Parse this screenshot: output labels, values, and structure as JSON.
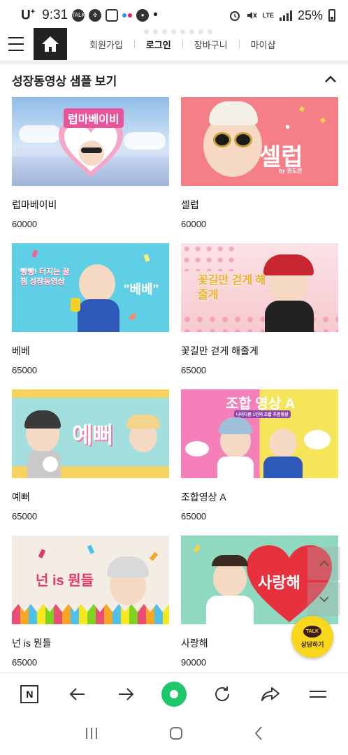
{
  "status": {
    "carrier": "U",
    "carrier_sup": "+",
    "time": "9:31",
    "talk_icon_text": "TALK",
    "network": "LTE",
    "battery": "25%"
  },
  "header": {
    "nav": [
      "회원가입",
      "로그인",
      "장바구니",
      "마이샵"
    ]
  },
  "section": {
    "title": "성장동영상 샘플 보기"
  },
  "products": [
    {
      "name": "럽마베이비",
      "price": "60000",
      "thumb_text": "럽마베이비",
      "thumb_sub": ""
    },
    {
      "name": "셀럽",
      "price": "60000",
      "thumb_text": "셀럽",
      "thumb_sub": "by 권도은"
    },
    {
      "name": "베베",
      "price": "65000",
      "thumb_text": "\"베베\"",
      "thumb_sub": "빵빵! 터지는 꿀잼 성장동영상"
    },
    {
      "name": "꽃길만 걷게 해줄게",
      "price": "65000",
      "thumb_text": "꽃길만 걷게 해줄게",
      "thumb_sub": ""
    },
    {
      "name": "예뻐",
      "price": "65000",
      "thumb_text": "예뻐",
      "thumb_sub": ""
    },
    {
      "name": "조합영상 A",
      "price": "65000",
      "thumb_text": "조합 영상 A",
      "thumb_sub": "나이다른 1인의 조합 추천영상"
    },
    {
      "name": "넌 is 뭔들",
      "price": "65000",
      "thumb_text": "넌 is 뭔들",
      "thumb_sub": ""
    },
    {
      "name": "사랑해",
      "price": "90000",
      "thumb_text": "사랑해",
      "thumb_sub": ""
    }
  ],
  "floating": {
    "kakao_bubble": "TALK",
    "kakao_label": "상담하기"
  },
  "toolbar": {
    "n_label": "N"
  },
  "colors": {
    "accent_green": "#1ec76c",
    "kakao_yellow": "#f9d71c"
  }
}
